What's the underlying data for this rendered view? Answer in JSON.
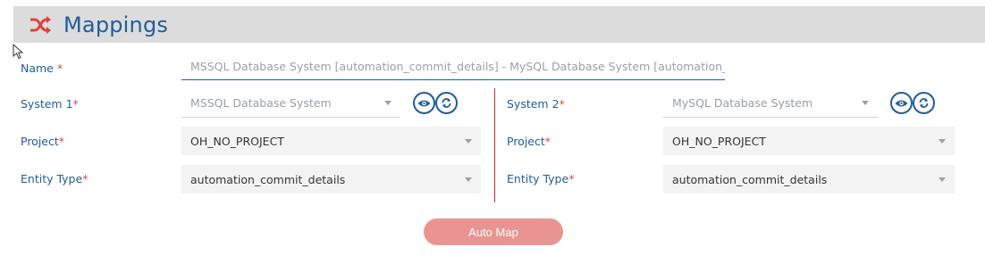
{
  "header": {
    "title": "Mappings"
  },
  "form": {
    "name": {
      "label": "Name",
      "required_mark": " *",
      "value": "MSSQL Database System [automation_commit_details] - MySQL Database System [automation_"
    },
    "left": {
      "system": {
        "label": "System 1",
        "required_mark": "*",
        "value": "MSSQL Database System"
      },
      "project": {
        "label": "Project",
        "required_mark": "*",
        "value": "OH_NO_PROJECT"
      },
      "entity": {
        "label": "Entity Type",
        "required_mark": "*",
        "value": "automation_commit_details"
      }
    },
    "right": {
      "system": {
        "label": "System 2",
        "required_mark": "*",
        "value": "MySQL Database System"
      },
      "project": {
        "label": "Project",
        "required_mark": "*",
        "value": "OH_NO_PROJECT"
      },
      "entity": {
        "label": "Entity Type",
        "required_mark": "*",
        "value": "automation_commit_details"
      }
    }
  },
  "actions": {
    "auto_map_label": "Auto Map"
  },
  "icons": {
    "header": "shuffle-icon",
    "view": "eye-icon",
    "refresh": "refresh-icon",
    "cursor": "mouse-cursor-icon"
  },
  "colors": {
    "accent": "#1f5e9a",
    "brand": "#e0413d",
    "required": "#d84a48",
    "button": "#e99492",
    "header_bg": "#dcdcdc",
    "divider": "#c9302c"
  }
}
